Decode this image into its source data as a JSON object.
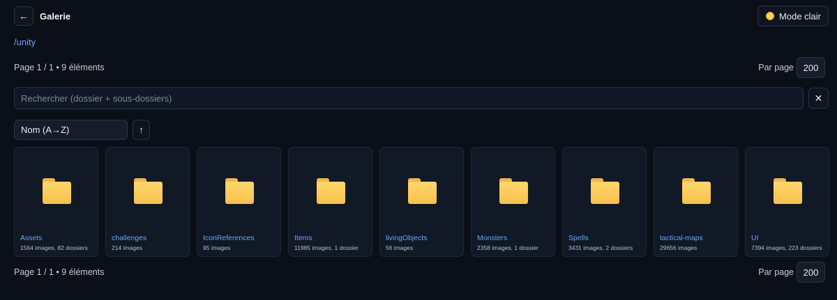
{
  "header": {
    "back_icon": "←",
    "title": "Galerie",
    "theme_button_label": "Mode clair"
  },
  "breadcrumb": "/unity",
  "pagination_top": {
    "info": "Page 1 / 1 • 9 éléments",
    "per_page_label": "Par page",
    "per_page_value": "200"
  },
  "search": {
    "placeholder": "Rechercher (dossier + sous-dossiers)",
    "value": "",
    "clear_icon": "✕"
  },
  "sort": {
    "selected": "Nom (A→Z)",
    "direction_icon": "↑"
  },
  "folders": [
    {
      "name": "Assets",
      "meta": "1564 images, 82 dossiers"
    },
    {
      "name": "challenges",
      "meta": "214 images"
    },
    {
      "name": "IconReferences",
      "meta": "95 images"
    },
    {
      "name": "Items",
      "meta": "11985 images, 1 dossier"
    },
    {
      "name": "livingObjects",
      "meta": "56 images"
    },
    {
      "name": "Monsters",
      "meta": "2358 images, 1 dossier"
    },
    {
      "name": "Spells",
      "meta": "3431 images, 2 dossiers"
    },
    {
      "name": "tactical-maps",
      "meta": "29656 images"
    },
    {
      "name": "UI",
      "meta": "7394 images, 223 dossiers"
    }
  ],
  "pagination_bottom": {
    "info": "Page 1 / 1 • 9 éléments",
    "per_page_label": "Par page",
    "per_page_value": "200"
  },
  "colors": {
    "background": "#0b0f17",
    "accent_link": "#6aa6f7",
    "folder_icon": "#f7c04f"
  },
  "icons": {
    "back": "arrow-left-icon",
    "theme": "sun-icon",
    "clear": "close-icon",
    "sort_direction": "arrow-up-icon",
    "folder": "folder-icon"
  }
}
